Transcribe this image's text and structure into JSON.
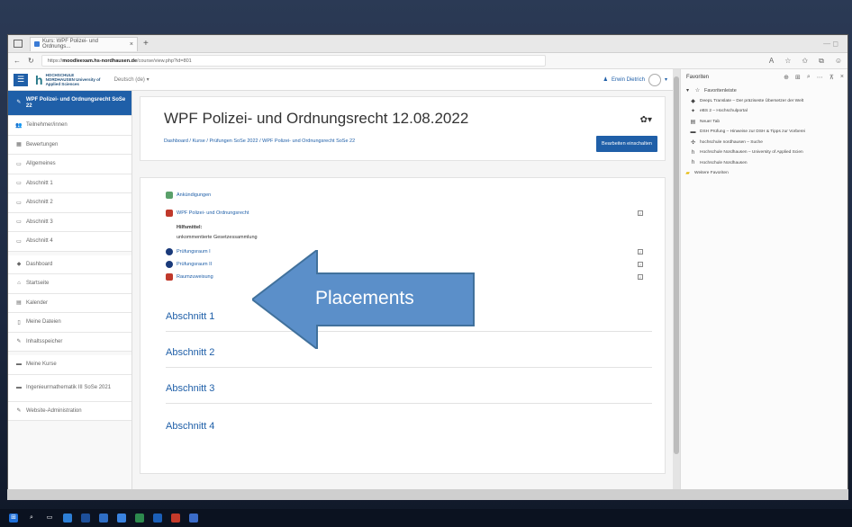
{
  "browser": {
    "tab_title": "Kurs: WPF Polizei- und Ordnungs...",
    "new_tab": "+",
    "url_prefix": "https://",
    "url_host": "moodleexam.hs-nordhausen.de",
    "url_path": "/course/view.php?id=801",
    "window_controls": "—  ◻"
  },
  "moodle_header": {
    "logo_text": "HOCHSCHULE NORDHAUSEN University of Applied Sciences",
    "language": "Deutsch (de) ▾",
    "user_name": "Erwin Dietrich",
    "menu_icon": "☰"
  },
  "sidebar": {
    "items": [
      {
        "label": "WPF Polizei- und Ordnungsrecht SoSe 22",
        "icon": "✎"
      },
      {
        "label": "Teilnehmer/innen",
        "icon": "👥"
      },
      {
        "label": "Bewertungen",
        "icon": "▦"
      },
      {
        "label": "Allgemeines",
        "icon": "▭"
      },
      {
        "label": "Abschnitt 1",
        "icon": "▭"
      },
      {
        "label": "Abschnitt 2",
        "icon": "▭"
      },
      {
        "label": "Abschnitt 3",
        "icon": "▭"
      },
      {
        "label": "Abschnitt 4",
        "icon": "▭"
      },
      {
        "label": "Dashboard",
        "icon": "◆"
      },
      {
        "label": "Startseite",
        "icon": "⌂"
      },
      {
        "label": "Kalender",
        "icon": "▤"
      },
      {
        "label": "Meine Dateien",
        "icon": "▯"
      },
      {
        "label": "Inhaltsspeicher",
        "icon": "✎"
      },
      {
        "label": "Meine Kurse",
        "icon": "▬"
      },
      {
        "label": "Ingenieurmathematik III SoSe 2021",
        "icon": "▬"
      },
      {
        "label": "Website-Administration",
        "icon": "✎"
      }
    ]
  },
  "course": {
    "title": "WPF Polizei- und Ordnungsrecht 12.08.2022",
    "breadcrumb": "Dashboard  /  Kurse  /  Prüfungen SoSe 2022  /  WPF Polizei- und Ordnungsrecht SoSe 22",
    "edit_button": "Bearbeiten einschalten",
    "gear": "✿▾"
  },
  "activities": [
    {
      "label": "Ankündigungen",
      "color": "#5aa06a",
      "check": false
    },
    {
      "label": "WPF Polizei- und Ordnungsrecht",
      "color": "#c0392b",
      "check": true
    },
    {
      "label": "Prüfungsraum I",
      "color": "#1a3a7a",
      "check": true
    },
    {
      "label": "Prüfungsraum II",
      "color": "#1a3a7a",
      "check": true
    },
    {
      "label": "Raumzuweisung",
      "color": "#c0392b",
      "check": true
    }
  ],
  "hilfsmittel": {
    "heading": "Hilfsmittel:",
    "text": "unkommentierte Gesetzessammlung"
  },
  "sections": [
    "Abschnitt 1",
    "Abschnitt 2",
    "Abschnitt 3",
    "Abschnitt 4"
  ],
  "annotation": {
    "text": "Placements",
    "color": "#5b8fc9"
  },
  "favorites": {
    "title": "Favoriten",
    "root": "Favoritenleiste",
    "items": [
      {
        "label": "DeepL Translate – Der präziseste Übersetzer der Welt",
        "icon": "◆"
      },
      {
        "label": "eBS 2 – Hochschulportal",
        "icon": "✦"
      },
      {
        "label": "Neuer Tab",
        "icon": "▤"
      },
      {
        "label": "DSH Prüfung – Hinweise zur DSH & Tipps zur Vorberei",
        "icon": "▬"
      },
      {
        "label": "hochschule nordhausen – Suche",
        "icon": "✣"
      },
      {
        "label": "Hochschule Nordhausen – University of Applied Scien",
        "icon": "h"
      },
      {
        "label": "Hochschule Nordhausen",
        "icon": "h"
      },
      {
        "label": "Weitere Favoriten",
        "icon": "▰"
      }
    ]
  }
}
